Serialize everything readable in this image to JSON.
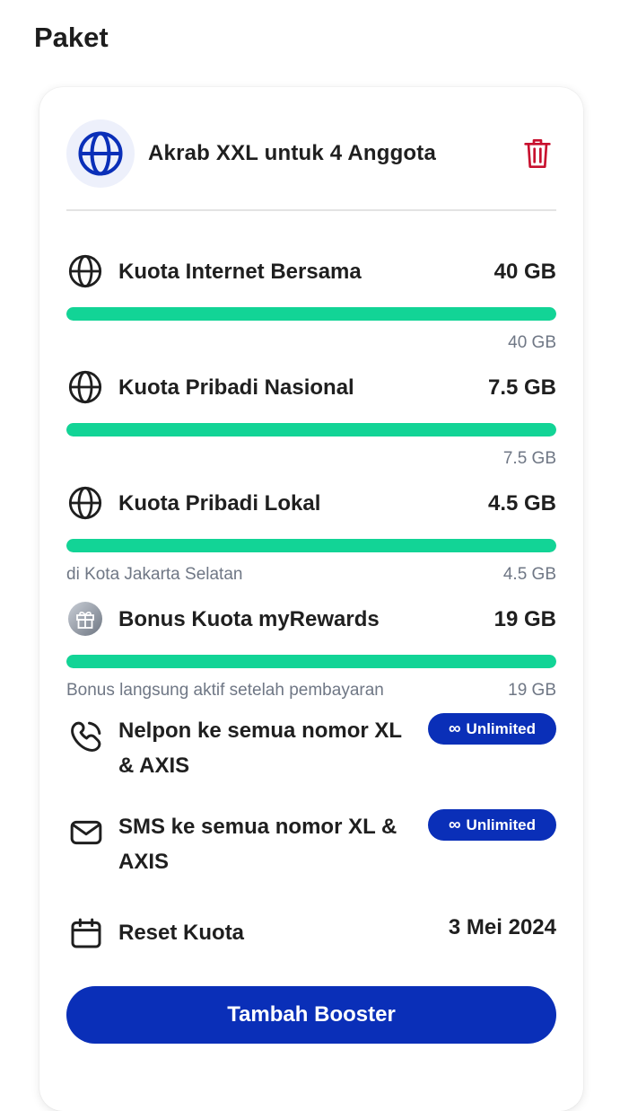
{
  "page": {
    "title": "Paket"
  },
  "package": {
    "name": "Akrab XXL untuk 4 Anggota",
    "icon": "globe-icon",
    "delete_icon": "trash-icon"
  },
  "quotas": [
    {
      "icon": "globe-icon",
      "label": "Kuota Internet Bersama",
      "value": "40 GB",
      "remaining": "40 GB",
      "note": "",
      "fill_fraction": 1.0
    },
    {
      "icon": "globe-icon",
      "label": "Kuota Pribadi Nasional",
      "value": "7.5 GB",
      "remaining": "7.5 GB",
      "note": "",
      "fill_fraction": 1.0
    },
    {
      "icon": "globe-icon",
      "label": "Kuota Pribadi Lokal",
      "value": "4.5 GB",
      "remaining": "4.5 GB",
      "note": "di Kota Jakarta Selatan",
      "fill_fraction": 1.0
    },
    {
      "icon": "gift-icon",
      "label": "Bonus Kuota myRewards",
      "value": "19 GB",
      "remaining": "19 GB",
      "note": "Bonus langsung aktif setelah pembayaran",
      "fill_fraction": 1.0
    }
  ],
  "features": [
    {
      "icon": "phone-icon",
      "label": "Nelpon ke semua nomor XL & AXIS",
      "badge": "Unlimited",
      "badge_symbol": "∞"
    },
    {
      "icon": "mail-icon",
      "label": "SMS ke semua nomor XL & AXIS",
      "badge": "Unlimited",
      "badge_symbol": "∞"
    }
  ],
  "reset": {
    "icon": "calendar-icon",
    "label": "Reset Kuota",
    "date": "3 Mei 2024"
  },
  "actions": {
    "booster_label": "Tambah Booster"
  },
  "colors": {
    "accent": "#0a2fb8",
    "progress": "#12d496",
    "delete": "#c8102e",
    "muted_text": "#6f7785"
  }
}
